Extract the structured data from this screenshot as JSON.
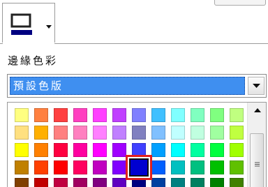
{
  "section_label": "邊緣色彩",
  "palette_select": {
    "value": "預設色版"
  },
  "line_color_button": {
    "current_color": "#000080",
    "icon": "line-color-icon"
  },
  "color_grid": {
    "selected_color": "#0000d0",
    "rows": [
      [
        "#ffff80",
        "#ff8040",
        "#ff4040",
        "#ff40c0",
        "#ff40ff",
        "#c040ff",
        "#8080ff",
        "#40c0ff",
        "#80ffff",
        "#80ffc0",
        "#80ff80",
        "#c0ff80"
      ],
      [
        "#ffe080",
        "#ffb000",
        "#ff8080",
        "#ff80c0",
        "#ff80ff",
        "#c080ff",
        "#8080c0",
        "#80c0ff",
        "#c0ffff",
        "#c0ffe0",
        "#a0ffa0",
        "#c0ff40"
      ],
      [
        "#ffff00",
        "#ff8000",
        "#ff0040",
        "#ff00a0",
        "#ff00ff",
        "#a000ff",
        "#4040ff",
        "#00a0ff",
        "#00ffff",
        "#00ffa0",
        "#00ff40",
        "#a0ff00"
      ],
      [
        "#c08000",
        "#ff4000",
        "#ff0000",
        "#ff0060",
        "#c000c0",
        "#8000ff",
        "#0000d0",
        "#0060ff",
        "#00c0c0",
        "#00c080",
        "#00c000",
        "#60c000"
      ],
      [
        "#804000",
        "#c00000",
        "#c00040",
        "#a00060",
        "#800080",
        "#6000c0",
        "#000080",
        "#0040a0",
        "#008080",
        "#008060",
        "#008000",
        "#408000"
      ]
    ]
  },
  "scrollbar": {
    "up_icon": "scroll-up-icon",
    "grip_icon": "scroll-grip-icon"
  }
}
